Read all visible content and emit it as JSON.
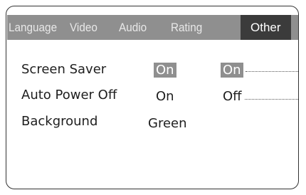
{
  "tabs": [
    {
      "label": "Language",
      "active": false
    },
    {
      "label": "Video",
      "active": false
    },
    {
      "label": "Audio",
      "active": false
    },
    {
      "label": "Rating",
      "active": false
    },
    {
      "label": "Other",
      "active": true
    }
  ],
  "settings": [
    {
      "label": "Screen Saver",
      "current": "On",
      "option": "On",
      "current_highlighted": true,
      "option_highlighted": true
    },
    {
      "label": "Auto Power Off",
      "current": "On",
      "option": "Off",
      "current_highlighted": false,
      "option_highlighted": false
    },
    {
      "label": "Background",
      "current": "Green"
    }
  ],
  "colors": {
    "tab_bar": "#8f8f8f",
    "active_tab": "#3b3b3b",
    "highlight": "#8f8f8f",
    "text": "#1e1e1e"
  }
}
